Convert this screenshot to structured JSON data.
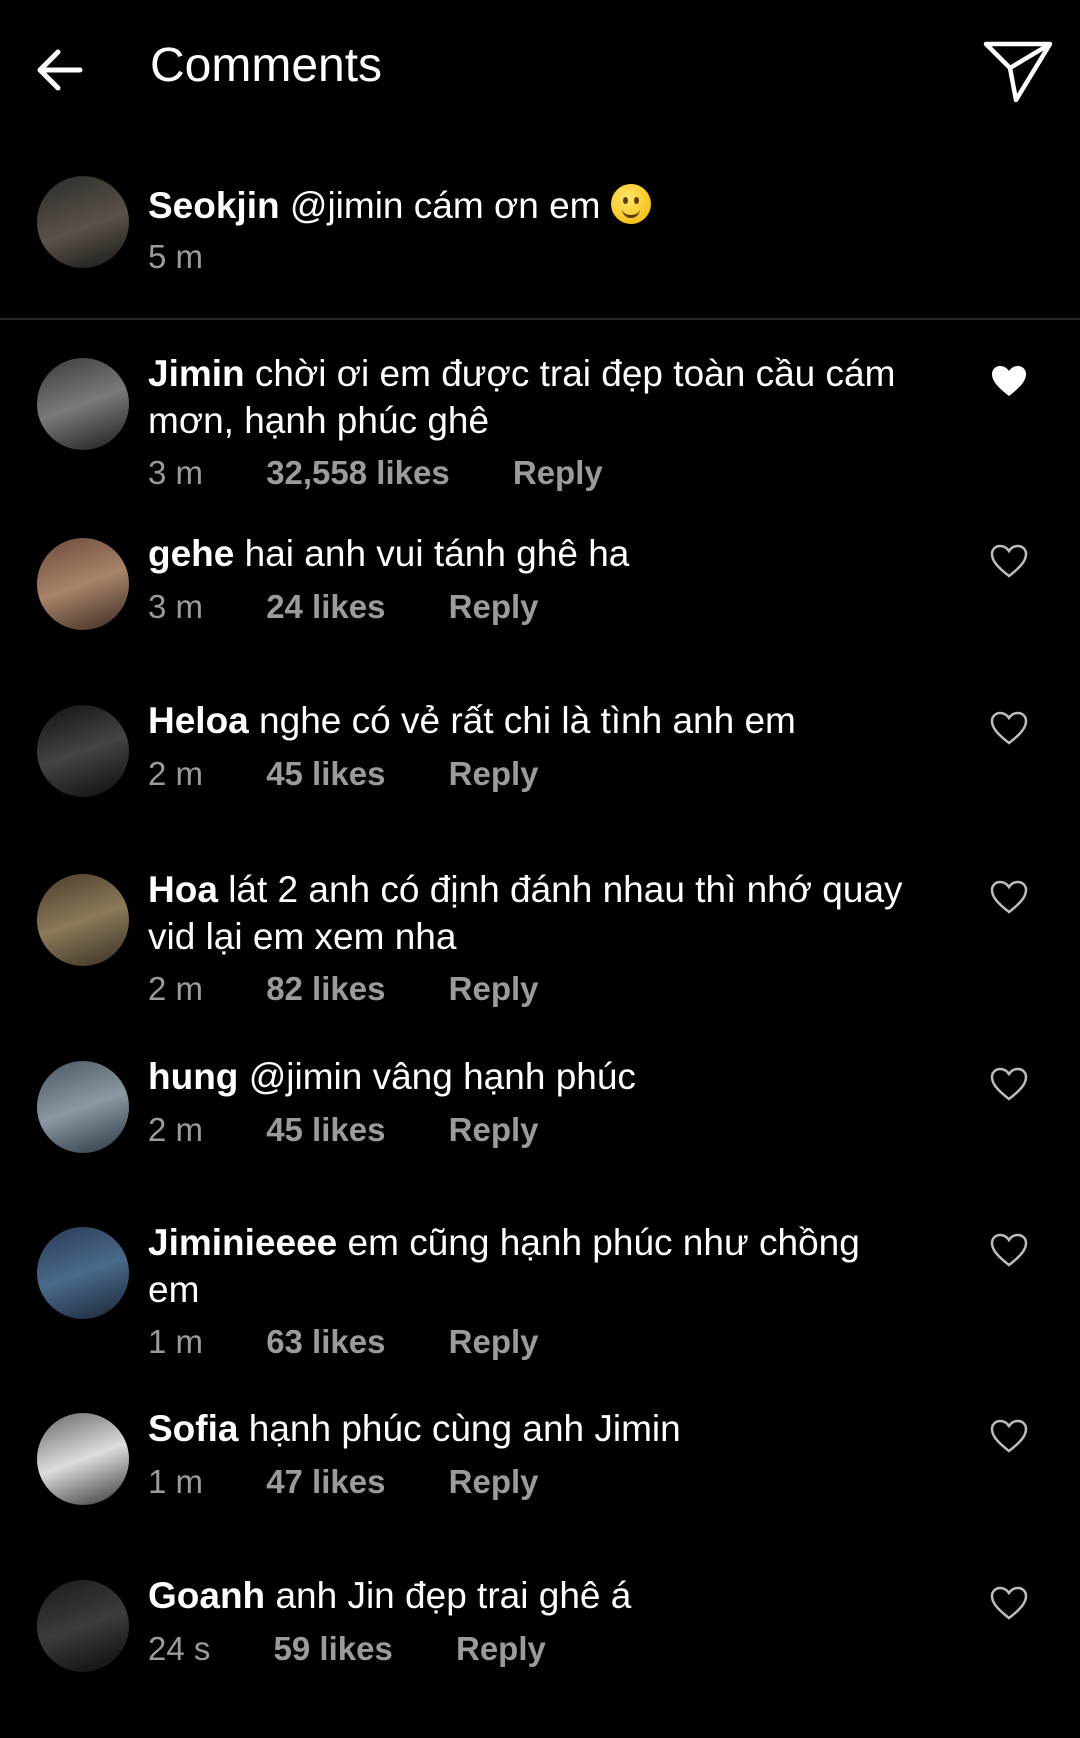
{
  "header": {
    "title": "Comments",
    "back_icon": "arrow-left-icon",
    "send_icon": "paper-plane-icon"
  },
  "caption": {
    "user": "Seokjin",
    "text": "@jimin cám ơn em",
    "time": "5 m"
  },
  "comments": [
    {
      "user": "Jimin",
      "text": "chời ơi em được trai đẹp toàn cầu cám mơn, hạnh phúc ghê",
      "time": "3 m",
      "likes": "32,558 likes",
      "reply": "Reply",
      "liked": true
    },
    {
      "user": "gehe",
      "text": "hai anh vui tánh ghê ha",
      "time": "3 m",
      "likes": "24 likes",
      "reply": "Reply",
      "liked": false
    },
    {
      "user": "Heloa",
      "text": "nghe có vẻ rất chi là tình anh em",
      "time": "2 m",
      "likes": "45 likes",
      "reply": "Reply",
      "liked": false
    },
    {
      "user": "Hoa",
      "text": "lát 2 anh có định đánh nhau thì nhớ quay vid lại em xem nha",
      "time": "2 m",
      "likes": "82 likes",
      "reply": "Reply",
      "liked": false
    },
    {
      "user": "hung",
      "text": "@jimin vâng hạnh phúc",
      "time": "2 m",
      "likes": "45 likes",
      "reply": "Reply",
      "liked": false
    },
    {
      "user": "Jiminieeee",
      "text": "em cũng hạnh phúc như chồng em",
      "time": "1 m",
      "likes": "63 likes",
      "reply": "Reply",
      "liked": false
    },
    {
      "user": "Sofia",
      "text": "hạnh phúc cùng anh Jimin",
      "time": "1 m",
      "likes": "47 likes",
      "reply": "Reply",
      "liked": false
    },
    {
      "user": "Goanh",
      "text": "anh Jin đẹp trai ghê á",
      "time": "24 s",
      "likes": "59 likes",
      "reply": "Reply",
      "liked": false
    }
  ]
}
